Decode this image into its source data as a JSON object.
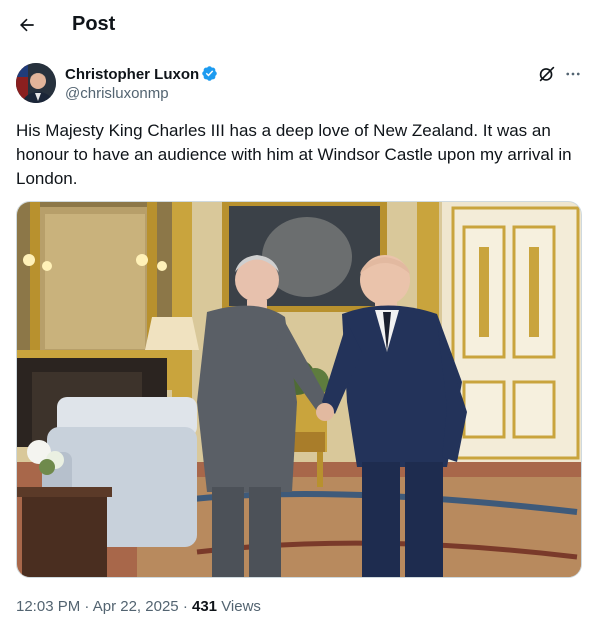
{
  "header": {
    "title": "Post"
  },
  "author": {
    "name": "Christopher Luxon",
    "handle": "@chrisluxonmp"
  },
  "post": {
    "text": "His Majesty King Charles III has a deep love of New Zealand. It was an honour to have an audience with him at Windsor Castle upon my arrival in London."
  },
  "meta": {
    "time": "12:03 PM",
    "separator": "·",
    "date": "Apr 22, 2025",
    "views_count": "431",
    "views_label": "Views"
  },
  "colors": {
    "verified": "#1d9bf0",
    "secondary_text": "#536471",
    "primary_text": "#0f1419"
  },
  "icons": {
    "back": "arrow-left-icon",
    "verified": "verified-badge-icon",
    "grok": "grok-icon",
    "more": "more-horizontal-icon"
  }
}
